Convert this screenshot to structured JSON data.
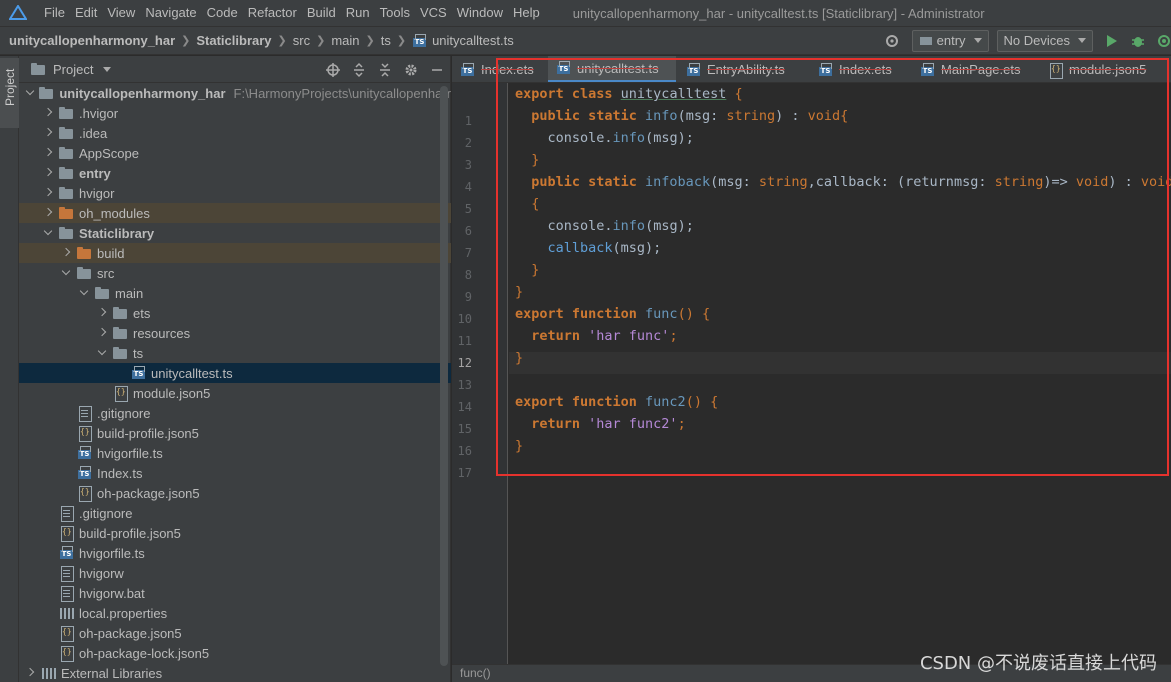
{
  "menubar": {
    "items": [
      "File",
      "Edit",
      "View",
      "Navigate",
      "Code",
      "Refactor",
      "Build",
      "Run",
      "Tools",
      "VCS",
      "Window",
      "Help"
    ],
    "window_title": "unitycallopenharmony_har - unitycalltest.ts [Staticlibrary] - Administrator"
  },
  "navbar": {
    "crumbs": [
      "unitycallopenharmony_har",
      "Staticlibrary",
      "src",
      "main",
      "ts",
      "unitycalltest.ts"
    ],
    "run_config": "entry",
    "device": "No Devices"
  },
  "toolstrip": {
    "project_label": "Project"
  },
  "project_panel": {
    "title": "Project",
    "tree": [
      {
        "label": "unitycallopenharmony_har",
        "path": "F:\\HarmonyProjects\\unitycallopenharr"
      },
      {
        "label": ".hvigor"
      },
      {
        "label": ".idea"
      },
      {
        "label": "AppScope"
      },
      {
        "label": "entry"
      },
      {
        "label": "hvigor"
      },
      {
        "label": "oh_modules"
      },
      {
        "label": "Staticlibrary"
      },
      {
        "label": "build"
      },
      {
        "label": "src"
      },
      {
        "label": "main"
      },
      {
        "label": "ets"
      },
      {
        "label": "resources"
      },
      {
        "label": "ts"
      },
      {
        "label": "unitycalltest.ts"
      },
      {
        "label": "module.json5"
      },
      {
        "label": ".gitignore"
      },
      {
        "label": "build-profile.json5"
      },
      {
        "label": "hvigorfile.ts"
      },
      {
        "label": "Index.ts"
      },
      {
        "label": "oh-package.json5"
      },
      {
        "label": ".gitignore"
      },
      {
        "label": "build-profile.json5"
      },
      {
        "label": "hvigorfile.ts"
      },
      {
        "label": "hvigorw"
      },
      {
        "label": "hvigorw.bat"
      },
      {
        "label": "local.properties"
      },
      {
        "label": "oh-package.json5"
      },
      {
        "label": "oh-package-lock.json5"
      },
      {
        "label": "External Libraries"
      }
    ]
  },
  "editor": {
    "tabs": [
      "Index.ets",
      "unitycalltest.ts",
      "EntryAbility.ts",
      "Index.ets",
      "MainPage.ets",
      "module.json5"
    ],
    "line_numbers": [
      "1",
      "2",
      "3",
      "4",
      "5",
      "6",
      "7",
      "8",
      "9",
      "10",
      "11",
      "12",
      "13",
      "14",
      "15",
      "16",
      "17"
    ],
    "code": {
      "l1_kw": "export class ",
      "l1_name": "unitycalltest",
      "l1_brace": " {",
      "l2_kw": "  public static ",
      "l2_fn": "info",
      "l2_rest": "(msg: ",
      "l2_type": "string",
      "l2_rest2": ") : ",
      "l2_void": "void",
      "l2_brace": "{",
      "l3_pre": "    console.",
      "l3_fn": "info",
      "l3_rest": "(msg);",
      "l4": "  }",
      "l5_kw": "  public static ",
      "l5_fn": "infoback",
      "l5_rest": "(msg: ",
      "l5_type": "string",
      "l5_rest2": ",callback: (returnmsg: ",
      "l5_type2": "string",
      "l5_rest3": ")=> ",
      "l5_void": "void",
      "l5_rest4": ") : ",
      "l5_void2": "void",
      "l6": "  {",
      "l7_pre": "    console.",
      "l7_fn": "info",
      "l7_rest": "(msg);",
      "l8_fn": "    callback",
      "l8_rest": "(msg);",
      "l9": "  }",
      "l10": "}",
      "l11_kw": "export function ",
      "l11_fn": "func",
      "l11_rest": "() {",
      "l12_kw": "  return ",
      "l12_str": "'har func'",
      "l12_rest": ";",
      "l13": "}",
      "l15_kw": "export function ",
      "l15_fn": "func2",
      "l15_rest": "() {",
      "l16_kw": "  return ",
      "l16_str": "'har func2'",
      "l16_rest": ";",
      "l17": "}"
    },
    "bottom_breadcrumb": "func()"
  },
  "watermark": "CSDN @不说废话直接上代码",
  "colors": {
    "keyword": "#cc7832",
    "function": "#6897bb",
    "string": "#6a8759",
    "highlight": "#e5322d"
  }
}
